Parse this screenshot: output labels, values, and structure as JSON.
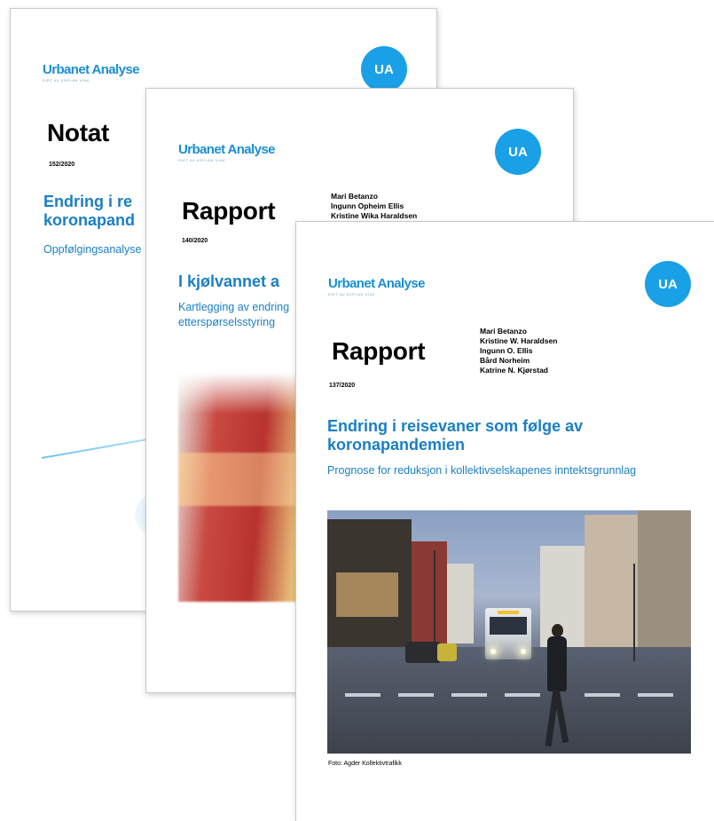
{
  "brand": {
    "logo_text": "Urbanet Analyse",
    "logo_sub": "DIET AV ASPLAN VIAK",
    "badge": "UA",
    "accent": "#1a8fd4"
  },
  "page1": {
    "doc_type": "Notat",
    "number": "152/2020",
    "title_lines": [
      "Endring i re",
      "koronapand"
    ],
    "subtitle": "Oppfølgingsanalyse"
  },
  "page2": {
    "doc_type": "Rapport",
    "number": "140/2020",
    "authors": [
      "Mari Betanzo",
      "Ingunn Opheim Ellis",
      "Kristine Wika Haraldsen"
    ],
    "title": "I kjølvannet a",
    "subtitle_lines": [
      "Kartlegging av endring",
      "etterspørselsstyring"
    ]
  },
  "page3": {
    "doc_type": "Rapport",
    "number": "137/2020",
    "authors": [
      "Mari Betanzo",
      "Kristine W. Haraldsen",
      "Ingunn O. Ellis",
      "Bård Norheim",
      "Katrine N. Kjørstad"
    ],
    "title_lines": [
      "Endring i reisevaner som følge av",
      "koronapandemien"
    ],
    "subtitle": "Prognose for reduksjon i kollektivselskapenes inntektsgrunnlag",
    "photo_caption": "Foto: Agder Kollektivtrafikk"
  }
}
